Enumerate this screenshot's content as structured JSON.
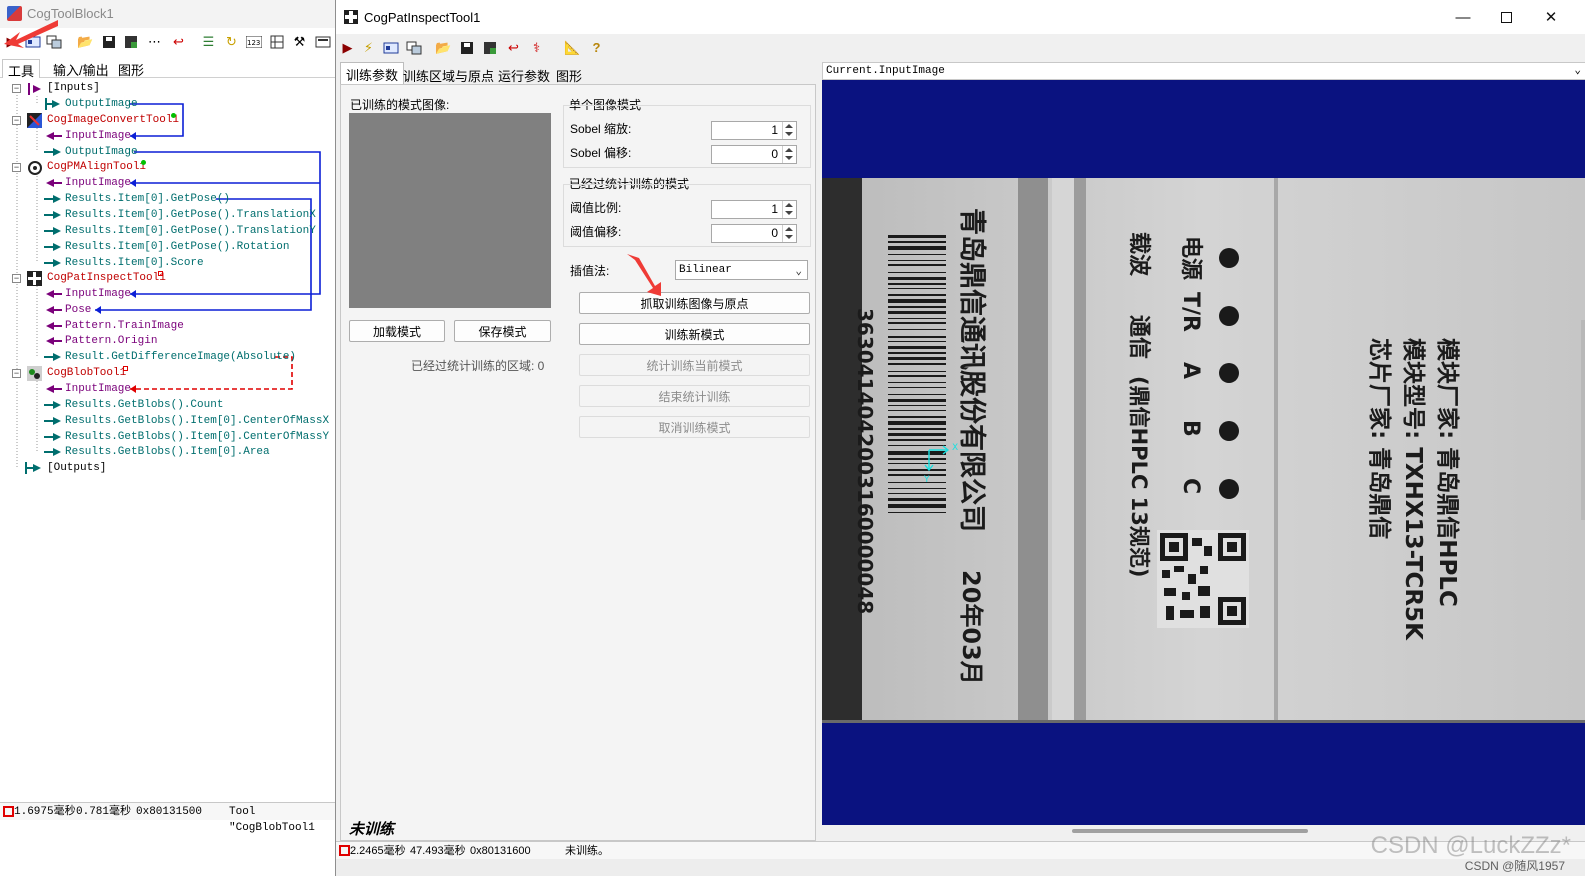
{
  "colors": {
    "accent_red": "#e53935",
    "tree_red": "#c00000",
    "tree_teal": "#006e6e",
    "tree_purple": "#7a007a",
    "link_blue": "#0b1fd6",
    "display_bg": "#0a1280"
  },
  "back_window": {
    "title": "CogToolBlock1",
    "tabs": [
      "工具",
      "输入/输出",
      "图形"
    ],
    "tree": {
      "inputs": "[Inputs]",
      "inputs_output_image": "OutputImage",
      "tool1": "CogImageConvertTool1",
      "tool1_input": "InputImage",
      "tool1_output": "OutputImage",
      "tool2": "CogPMAlignTool1",
      "tool2_input": "InputImage",
      "tool2_r1": "Results.Item[0].GetPose()",
      "tool2_r2": "Results.Item[0].GetPose().TranslationX",
      "tool2_r3": "Results.Item[0].GetPose().TranslationY",
      "tool2_r4": "Results.Item[0].GetPose().Rotation",
      "tool2_r5": "Results.Item[0].Score",
      "tool3": "CogPatInspectTool1",
      "tool3_input": "InputImage",
      "tool3_pose": "Pose",
      "tool3_train": "Pattern.TrainImage",
      "tool3_origin": "Pattern.Origin",
      "tool3_diff": "Result.GetDifferenceImage(Absolute)",
      "tool4": "CogBlobTool1",
      "tool4_input": "InputImage",
      "tool4_r1": "Results.GetBlobs().Count",
      "tool4_r2": "Results.GetBlobs().Item[0].CenterOfMassX",
      "tool4_r3": "Results.GetBlobs().Item[0].CenterOfMassY",
      "tool4_r4": "Results.GetBlobs().Item[0].Area",
      "outputs": "[Outputs]"
    },
    "status": {
      "t1": "1.6975毫秒",
      "t2": "0.781毫秒",
      "code": "0x80131500",
      "msg": "Tool \"CogBlobTool1"
    }
  },
  "front_window": {
    "title": "CogPatInspectTool1",
    "tabs": [
      "训练参数",
      "训练区域与原点",
      "运行参数",
      "图形"
    ],
    "trained_pattern_label": "已训练的模式图像:",
    "single_mode": {
      "title": "单个图像模式",
      "sobel_scale_label": "Sobel 缩放:",
      "sobel_scale_value": "1",
      "sobel_offset_label": "Sobel 偏移:",
      "sobel_offset_value": "0"
    },
    "stat_mode": {
      "title": "已经过统计训练的模式",
      "threshold_ratio_label": "阈值比例:",
      "threshold_ratio_value": "1",
      "threshold_offset_label": "阈值偏移:",
      "threshold_offset_value": "0"
    },
    "interp_label": "插值法:",
    "interp_value": "Bilinear",
    "buttons": {
      "grab": "抓取训练图像与原点",
      "train_new": "训练新模式",
      "stat_train": "统计训练当前模式",
      "end_stat": "结束统计训练",
      "cancel_train": "取消训练模式",
      "load": "加载模式",
      "save": "保存模式"
    },
    "stat_region_label": "已经过统计训练的区域: 0",
    "untrained": "未训练",
    "display_source": "Current.InputImage",
    "status": {
      "t1": "2.2465毫秒",
      "t2": "47.493毫秒",
      "code": "0x80131600",
      "msg": "未训练。"
    }
  },
  "image_text": {
    "company": "青岛鼎信通讯股份有限公司",
    "date": "20年03月",
    "barcode_number": "3630414042003160000048",
    "power": "电源",
    "tr": "T/R",
    "a": "A",
    "b": "B",
    "c": "C",
    "carrier": "载波",
    "comm": "通信",
    "model_note": "(鼎信HPLC 13规范)",
    "maker": "模块厂家: 青岛鼎信HPLC",
    "model": "模块型号: TXHX13-TCR5K",
    "chip": "芯片厂家: 青岛鼎信"
  },
  "watermark": {
    "big": "CSDN @LuckZZz*",
    "small": "CSDN @随风1957"
  }
}
